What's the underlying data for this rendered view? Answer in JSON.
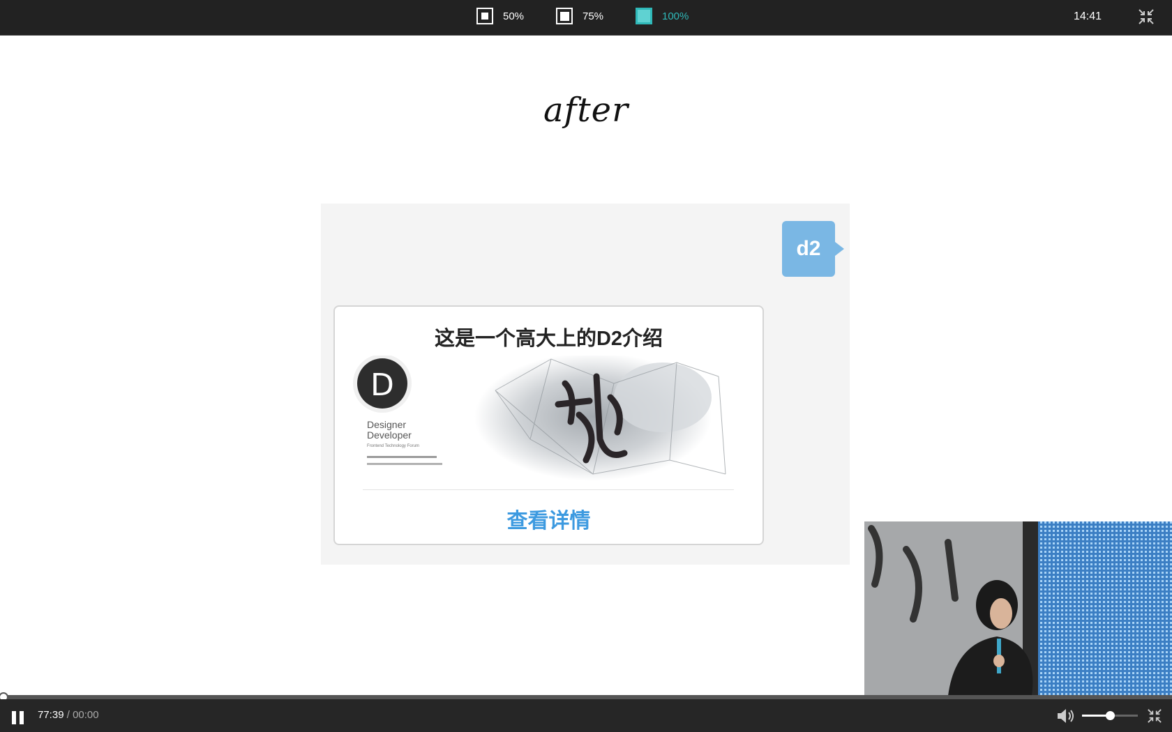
{
  "topbar": {
    "zoom_options": [
      {
        "label": "50%",
        "active": false
      },
      {
        "label": "75%",
        "active": false
      },
      {
        "label": "100%",
        "active": true
      }
    ],
    "clock": "14:41",
    "collapse_icon": "exit-fullscreen-icon"
  },
  "slide": {
    "title": "after",
    "avatar_label": "d2",
    "card": {
      "title": "这是一个高大上的D2介绍",
      "image_logo_text": "D",
      "image_text_line1": "Designer",
      "image_text_line2": "Developer",
      "image_text_line3": "Frontend Technology Forum",
      "link_label": "查看详情"
    }
  },
  "player": {
    "current_time": "77:39",
    "separator": "/",
    "total_time": "00:00",
    "progress": 0,
    "volume": 0.5,
    "pause_icon": "pause-icon",
    "volume_icon": "speaker-icon",
    "collapse_icon": "exit-fullscreen-icon"
  },
  "colors": {
    "accent": "#2fb8b8",
    "bar_bg": "#222222",
    "bubble": "#7ab7e4",
    "link": "#3d9ae0"
  }
}
